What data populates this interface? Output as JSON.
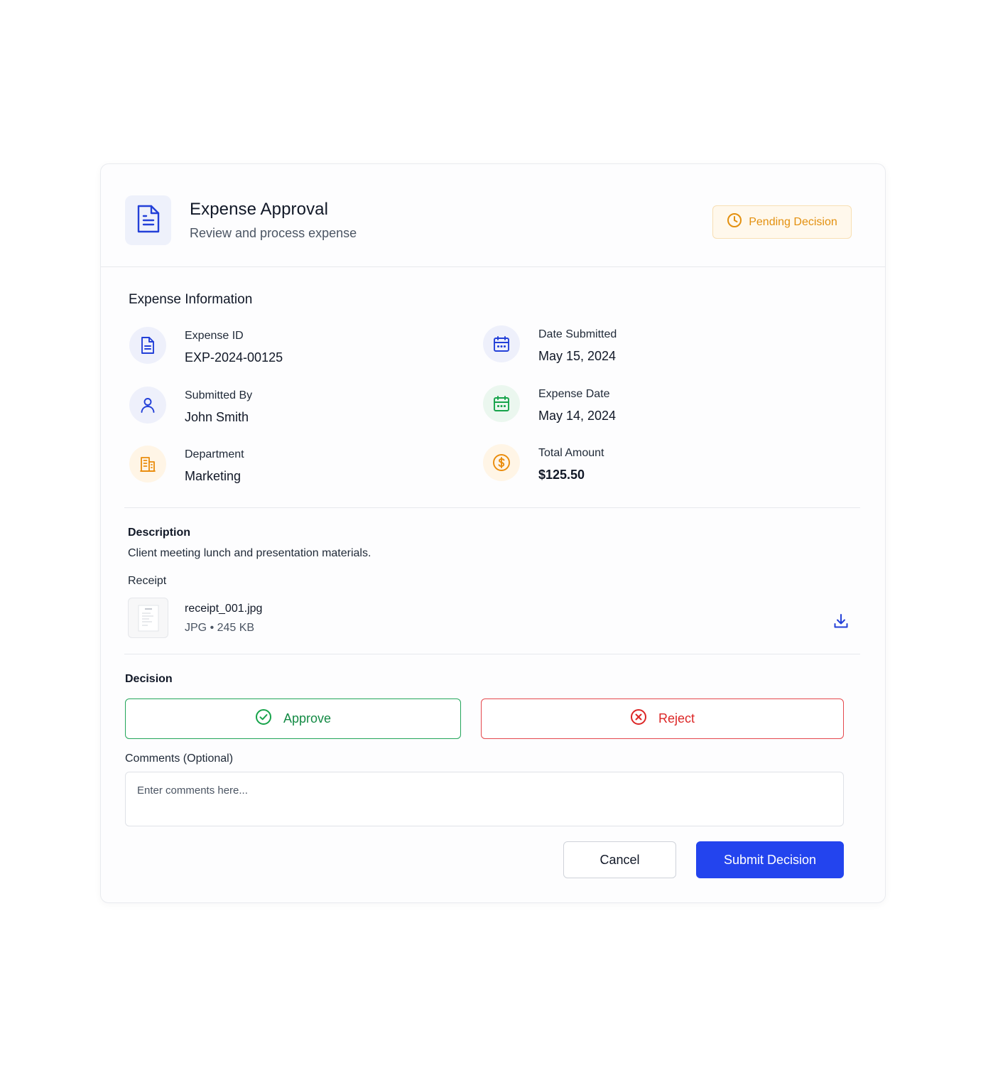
{
  "header": {
    "title": "Expense Approval",
    "subtitle": "Review and process expense",
    "icon": "document-icon",
    "status_badge": {
      "label": "Pending Decision",
      "icon": "clock-icon",
      "color": "#e3900f"
    }
  },
  "info_section": {
    "title": "Expense Information",
    "items": [
      {
        "label": "Expense ID",
        "value": "EXP-2024-00125",
        "icon": "document-icon",
        "color": "#2340d8"
      },
      {
        "label": "Date Submitted",
        "value": "May 15, 2024",
        "icon": "calendar-icon",
        "color": "#2340d8"
      },
      {
        "label": "Submitted By",
        "value": "John Smith",
        "icon": "user-icon",
        "color": "#2340d8"
      },
      {
        "label": "Expense Date",
        "value": "May 14, 2024",
        "icon": "calendar-icon",
        "color": "#16a34a"
      },
      {
        "label": "Department",
        "value": "Marketing",
        "icon": "building-icon",
        "color": "#ea8c0c"
      },
      {
        "label": "Total Amount",
        "value": "$125.50",
        "icon": "dollar-circle-icon",
        "color": "#ea8c0c"
      }
    ]
  },
  "description": {
    "label": "Description",
    "text": "Client meeting lunch and presentation materials."
  },
  "receipt": {
    "label": "Receipt",
    "file_name": "receipt_001.jpg",
    "file_meta": "JPG • 245 KB",
    "download_icon": "download-icon"
  },
  "decision": {
    "label": "Decision",
    "approve_label": "Approve",
    "reject_label": "Reject",
    "approve_color": "#138a44",
    "reject_color": "#dc2626"
  },
  "comments": {
    "label": "Comments (Optional)",
    "placeholder": "Enter comments here...",
    "value": ""
  },
  "actions": {
    "cancel_label": "Cancel",
    "submit_label": "Submit Decision",
    "submit_color": "#2344ee"
  }
}
